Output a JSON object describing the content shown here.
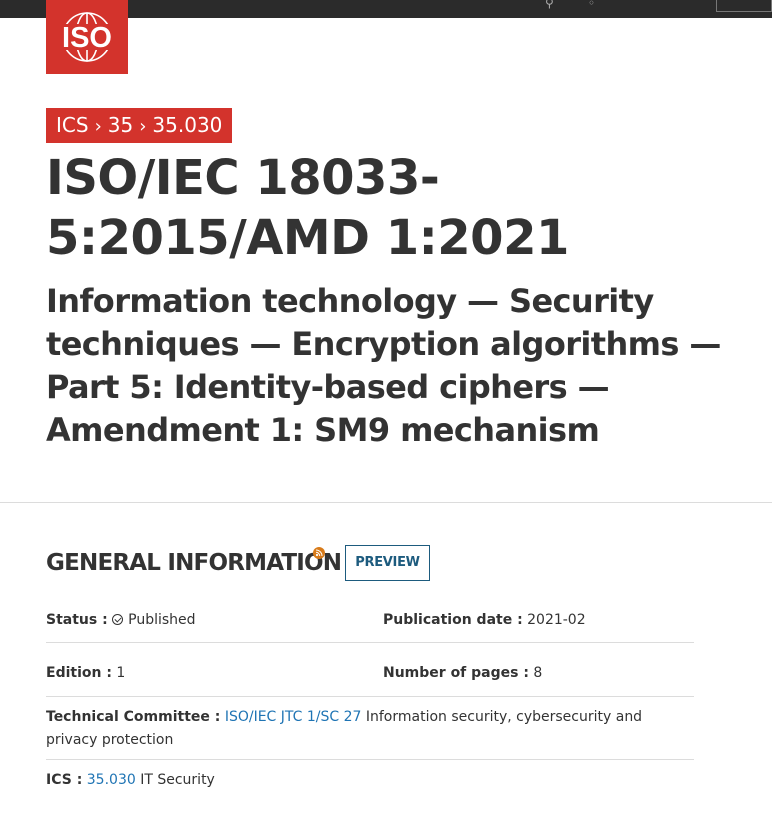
{
  "header": {
    "logo_text": "ISO"
  },
  "breadcrumb": {
    "items": [
      "ICS",
      "35",
      "35.030"
    ],
    "separator": "›"
  },
  "standard": {
    "title": "ISO/IEC 18033-5:2015/AMD 1:2021",
    "subtitle": "Information technology — Security techniques — Encryption algorithms — Part 5: Identity-based ciphers — Amendment 1: SM9 mechanism"
  },
  "general_info": {
    "heading": "GENERAL INFORMATION",
    "preview_label": "PREVIEW",
    "status_label": "Status :",
    "status_value": "Published",
    "publication_date_label": "Publication date :",
    "publication_date_value": "2021-02",
    "edition_label": "Edition :",
    "edition_value": "1",
    "pages_label": "Number of pages :",
    "pages_value": "8",
    "committee_label": "Technical Committee :",
    "committee_link": "ISO/IEC JTC 1/SC 27",
    "committee_desc": "Information security, cybersecurity and privacy protection",
    "ics_label": "ICS :",
    "ics_link": "35.030",
    "ics_desc": "IT Security"
  },
  "colors": {
    "brand_red": "#d3332c",
    "link_blue": "#1f74b4",
    "preview_blue": "#1d5b7e",
    "rss_orange": "#d87b1a"
  }
}
